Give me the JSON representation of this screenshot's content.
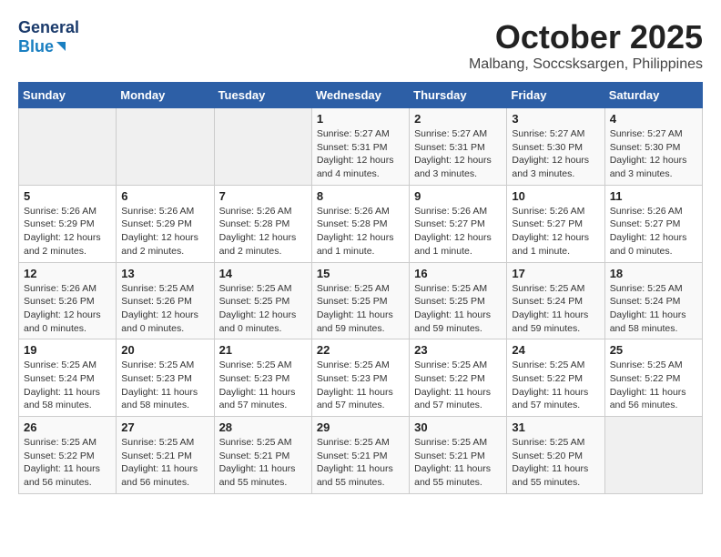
{
  "logo": {
    "line1": "General",
    "line2": "Blue"
  },
  "title": "October 2025",
  "subtitle": "Malbang, Soccsksargen, Philippines",
  "weekdays": [
    "Sunday",
    "Monday",
    "Tuesday",
    "Wednesday",
    "Thursday",
    "Friday",
    "Saturday"
  ],
  "weeks": [
    [
      {
        "day": "",
        "info": ""
      },
      {
        "day": "",
        "info": ""
      },
      {
        "day": "",
        "info": ""
      },
      {
        "day": "1",
        "info": "Sunrise: 5:27 AM\nSunset: 5:31 PM\nDaylight: 12 hours\nand 4 minutes."
      },
      {
        "day": "2",
        "info": "Sunrise: 5:27 AM\nSunset: 5:31 PM\nDaylight: 12 hours\nand 3 minutes."
      },
      {
        "day": "3",
        "info": "Sunrise: 5:27 AM\nSunset: 5:30 PM\nDaylight: 12 hours\nand 3 minutes."
      },
      {
        "day": "4",
        "info": "Sunrise: 5:27 AM\nSunset: 5:30 PM\nDaylight: 12 hours\nand 3 minutes."
      }
    ],
    [
      {
        "day": "5",
        "info": "Sunrise: 5:26 AM\nSunset: 5:29 PM\nDaylight: 12 hours\nand 2 minutes."
      },
      {
        "day": "6",
        "info": "Sunrise: 5:26 AM\nSunset: 5:29 PM\nDaylight: 12 hours\nand 2 minutes."
      },
      {
        "day": "7",
        "info": "Sunrise: 5:26 AM\nSunset: 5:28 PM\nDaylight: 12 hours\nand 2 minutes."
      },
      {
        "day": "8",
        "info": "Sunrise: 5:26 AM\nSunset: 5:28 PM\nDaylight: 12 hours\nand 1 minute."
      },
      {
        "day": "9",
        "info": "Sunrise: 5:26 AM\nSunset: 5:27 PM\nDaylight: 12 hours\nand 1 minute."
      },
      {
        "day": "10",
        "info": "Sunrise: 5:26 AM\nSunset: 5:27 PM\nDaylight: 12 hours\nand 1 minute."
      },
      {
        "day": "11",
        "info": "Sunrise: 5:26 AM\nSunset: 5:27 PM\nDaylight: 12 hours\nand 0 minutes."
      }
    ],
    [
      {
        "day": "12",
        "info": "Sunrise: 5:26 AM\nSunset: 5:26 PM\nDaylight: 12 hours\nand 0 minutes."
      },
      {
        "day": "13",
        "info": "Sunrise: 5:25 AM\nSunset: 5:26 PM\nDaylight: 12 hours\nand 0 minutes."
      },
      {
        "day": "14",
        "info": "Sunrise: 5:25 AM\nSunset: 5:25 PM\nDaylight: 12 hours\nand 0 minutes."
      },
      {
        "day": "15",
        "info": "Sunrise: 5:25 AM\nSunset: 5:25 PM\nDaylight: 11 hours\nand 59 minutes."
      },
      {
        "day": "16",
        "info": "Sunrise: 5:25 AM\nSunset: 5:25 PM\nDaylight: 11 hours\nand 59 minutes."
      },
      {
        "day": "17",
        "info": "Sunrise: 5:25 AM\nSunset: 5:24 PM\nDaylight: 11 hours\nand 59 minutes."
      },
      {
        "day": "18",
        "info": "Sunrise: 5:25 AM\nSunset: 5:24 PM\nDaylight: 11 hours\nand 58 minutes."
      }
    ],
    [
      {
        "day": "19",
        "info": "Sunrise: 5:25 AM\nSunset: 5:24 PM\nDaylight: 11 hours\nand 58 minutes."
      },
      {
        "day": "20",
        "info": "Sunrise: 5:25 AM\nSunset: 5:23 PM\nDaylight: 11 hours\nand 58 minutes."
      },
      {
        "day": "21",
        "info": "Sunrise: 5:25 AM\nSunset: 5:23 PM\nDaylight: 11 hours\nand 57 minutes."
      },
      {
        "day": "22",
        "info": "Sunrise: 5:25 AM\nSunset: 5:23 PM\nDaylight: 11 hours\nand 57 minutes."
      },
      {
        "day": "23",
        "info": "Sunrise: 5:25 AM\nSunset: 5:22 PM\nDaylight: 11 hours\nand 57 minutes."
      },
      {
        "day": "24",
        "info": "Sunrise: 5:25 AM\nSunset: 5:22 PM\nDaylight: 11 hours\nand 57 minutes."
      },
      {
        "day": "25",
        "info": "Sunrise: 5:25 AM\nSunset: 5:22 PM\nDaylight: 11 hours\nand 56 minutes."
      }
    ],
    [
      {
        "day": "26",
        "info": "Sunrise: 5:25 AM\nSunset: 5:22 PM\nDaylight: 11 hours\nand 56 minutes."
      },
      {
        "day": "27",
        "info": "Sunrise: 5:25 AM\nSunset: 5:21 PM\nDaylight: 11 hours\nand 56 minutes."
      },
      {
        "day": "28",
        "info": "Sunrise: 5:25 AM\nSunset: 5:21 PM\nDaylight: 11 hours\nand 55 minutes."
      },
      {
        "day": "29",
        "info": "Sunrise: 5:25 AM\nSunset: 5:21 PM\nDaylight: 11 hours\nand 55 minutes."
      },
      {
        "day": "30",
        "info": "Sunrise: 5:25 AM\nSunset: 5:21 PM\nDaylight: 11 hours\nand 55 minutes."
      },
      {
        "day": "31",
        "info": "Sunrise: 5:25 AM\nSunset: 5:20 PM\nDaylight: 11 hours\nand 55 minutes."
      },
      {
        "day": "",
        "info": ""
      }
    ]
  ]
}
